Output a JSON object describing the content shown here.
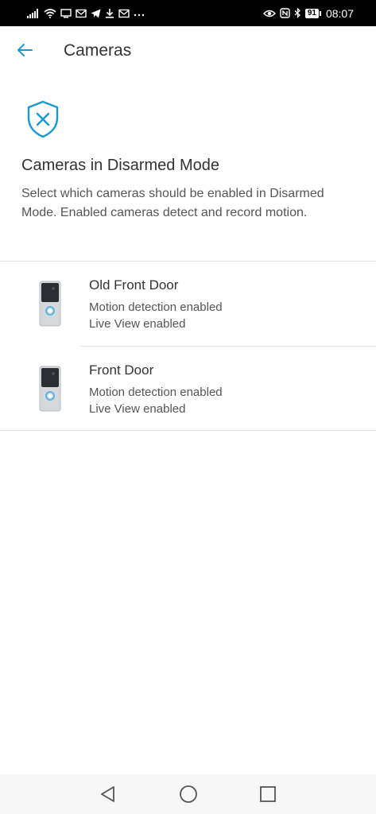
{
  "status_bar": {
    "time": "08:07",
    "battery": "91",
    "left_icons": [
      "signal-icon",
      "wifi-icon",
      "screen-icon",
      "mail-icon",
      "telegram-icon",
      "download-icon",
      "mail-icon",
      "more-icon"
    ],
    "right_icons": [
      "eye-icon",
      "nfc-icon",
      "bluetooth-icon"
    ]
  },
  "header": {
    "back_icon": "arrow-left-icon",
    "title": "Cameras"
  },
  "intro": {
    "icon": "shield-x-icon",
    "heading": "Cameras in Disarmed Mode",
    "description": "Select which cameras should be enabled in Disarmed Mode. Enabled cameras detect and record motion."
  },
  "cameras": [
    {
      "name": "Old Front Door",
      "motion": "Motion detection enabled",
      "live_view": "Live View enabled",
      "icon": "doorbell-icon"
    },
    {
      "name": "Front Door",
      "motion": "Motion detection enabled",
      "live_view": "Live View enabled",
      "icon": "doorbell-icon"
    }
  ],
  "nav_bar": {
    "back": "nav-back-icon",
    "home": "nav-home-icon",
    "recents": "nav-recents-icon"
  },
  "colors": {
    "accent": "#1998d5",
    "status_bar": "#000000",
    "background": "#ffffff",
    "divider": "#e5e5e5"
  }
}
